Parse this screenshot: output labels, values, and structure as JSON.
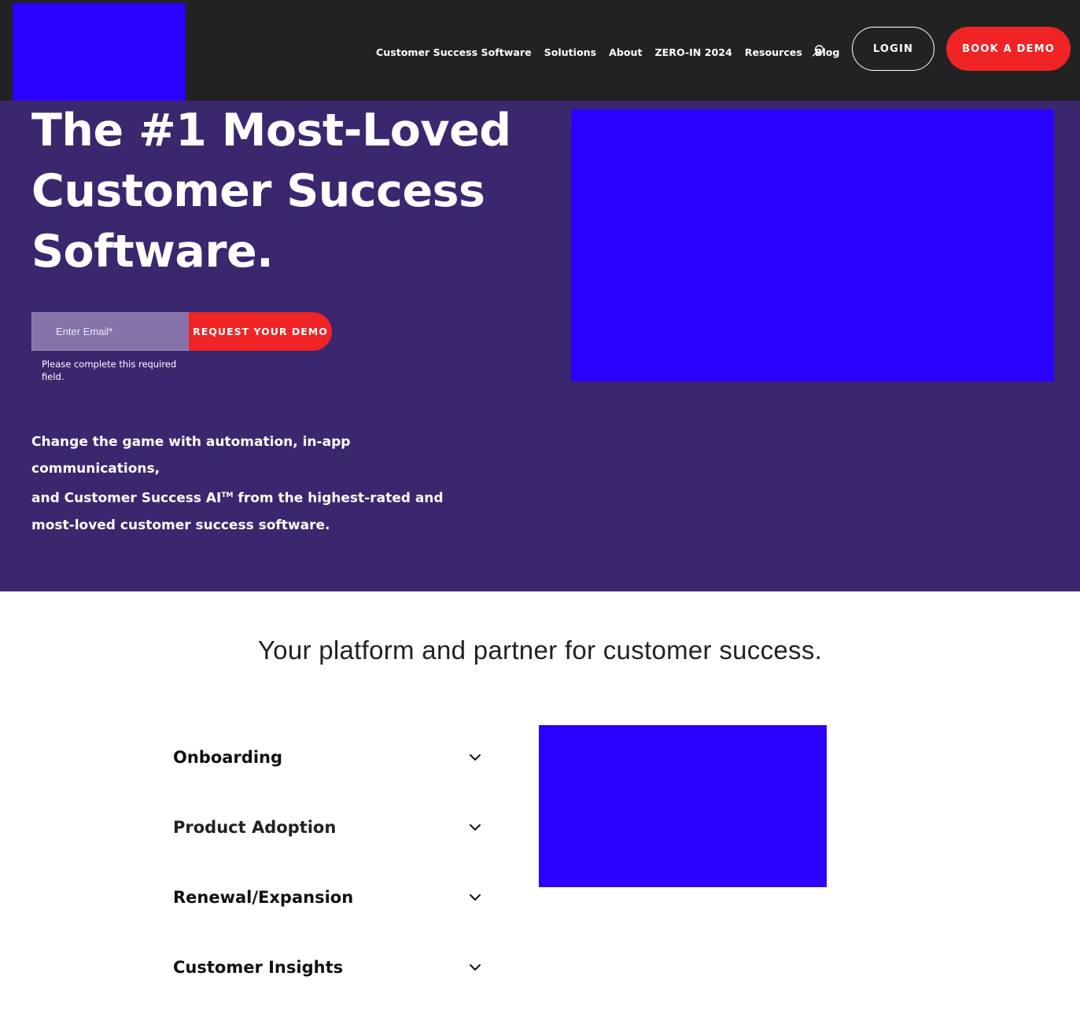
{
  "header": {
    "nav": [
      {
        "label": "Customer Success Software"
      },
      {
        "label": "Solutions"
      },
      {
        "label": "About"
      },
      {
        "label": "ZERO-IN 2024"
      },
      {
        "label": "Resources"
      },
      {
        "label": "Blog"
      }
    ],
    "search_icon": "search-icon",
    "login_label": "LOGIN",
    "demo_label": "BOOK A DEMO"
  },
  "hero": {
    "title_lines": [
      "The #1 Most-Loved",
      "Customer Success",
      "Software."
    ],
    "email_placeholder": "Enter Email*",
    "request_label": "REQUEST YOUR DEMO",
    "error_message": "Please complete this required field.",
    "description_line1": "Change the game with automation, in-app communications,",
    "description_line2": "and Customer Success AI",
    "description_tm": "TM",
    "description_line2b": " from the highest-rated and",
    "description_line3": "most-loved customer success software."
  },
  "platform": {
    "title": "Your platform and partner for customer success.",
    "items": [
      {
        "label": "Onboarding"
      },
      {
        "label": "Product Adoption"
      },
      {
        "label": "Renewal/Expansion"
      },
      {
        "label": "Customer Insights"
      }
    ]
  },
  "colors": {
    "header_bg": "#222222",
    "hero_bg": "#3b276e",
    "accent_red": "#f02424",
    "placeholder_blue": "#2a00ff"
  }
}
